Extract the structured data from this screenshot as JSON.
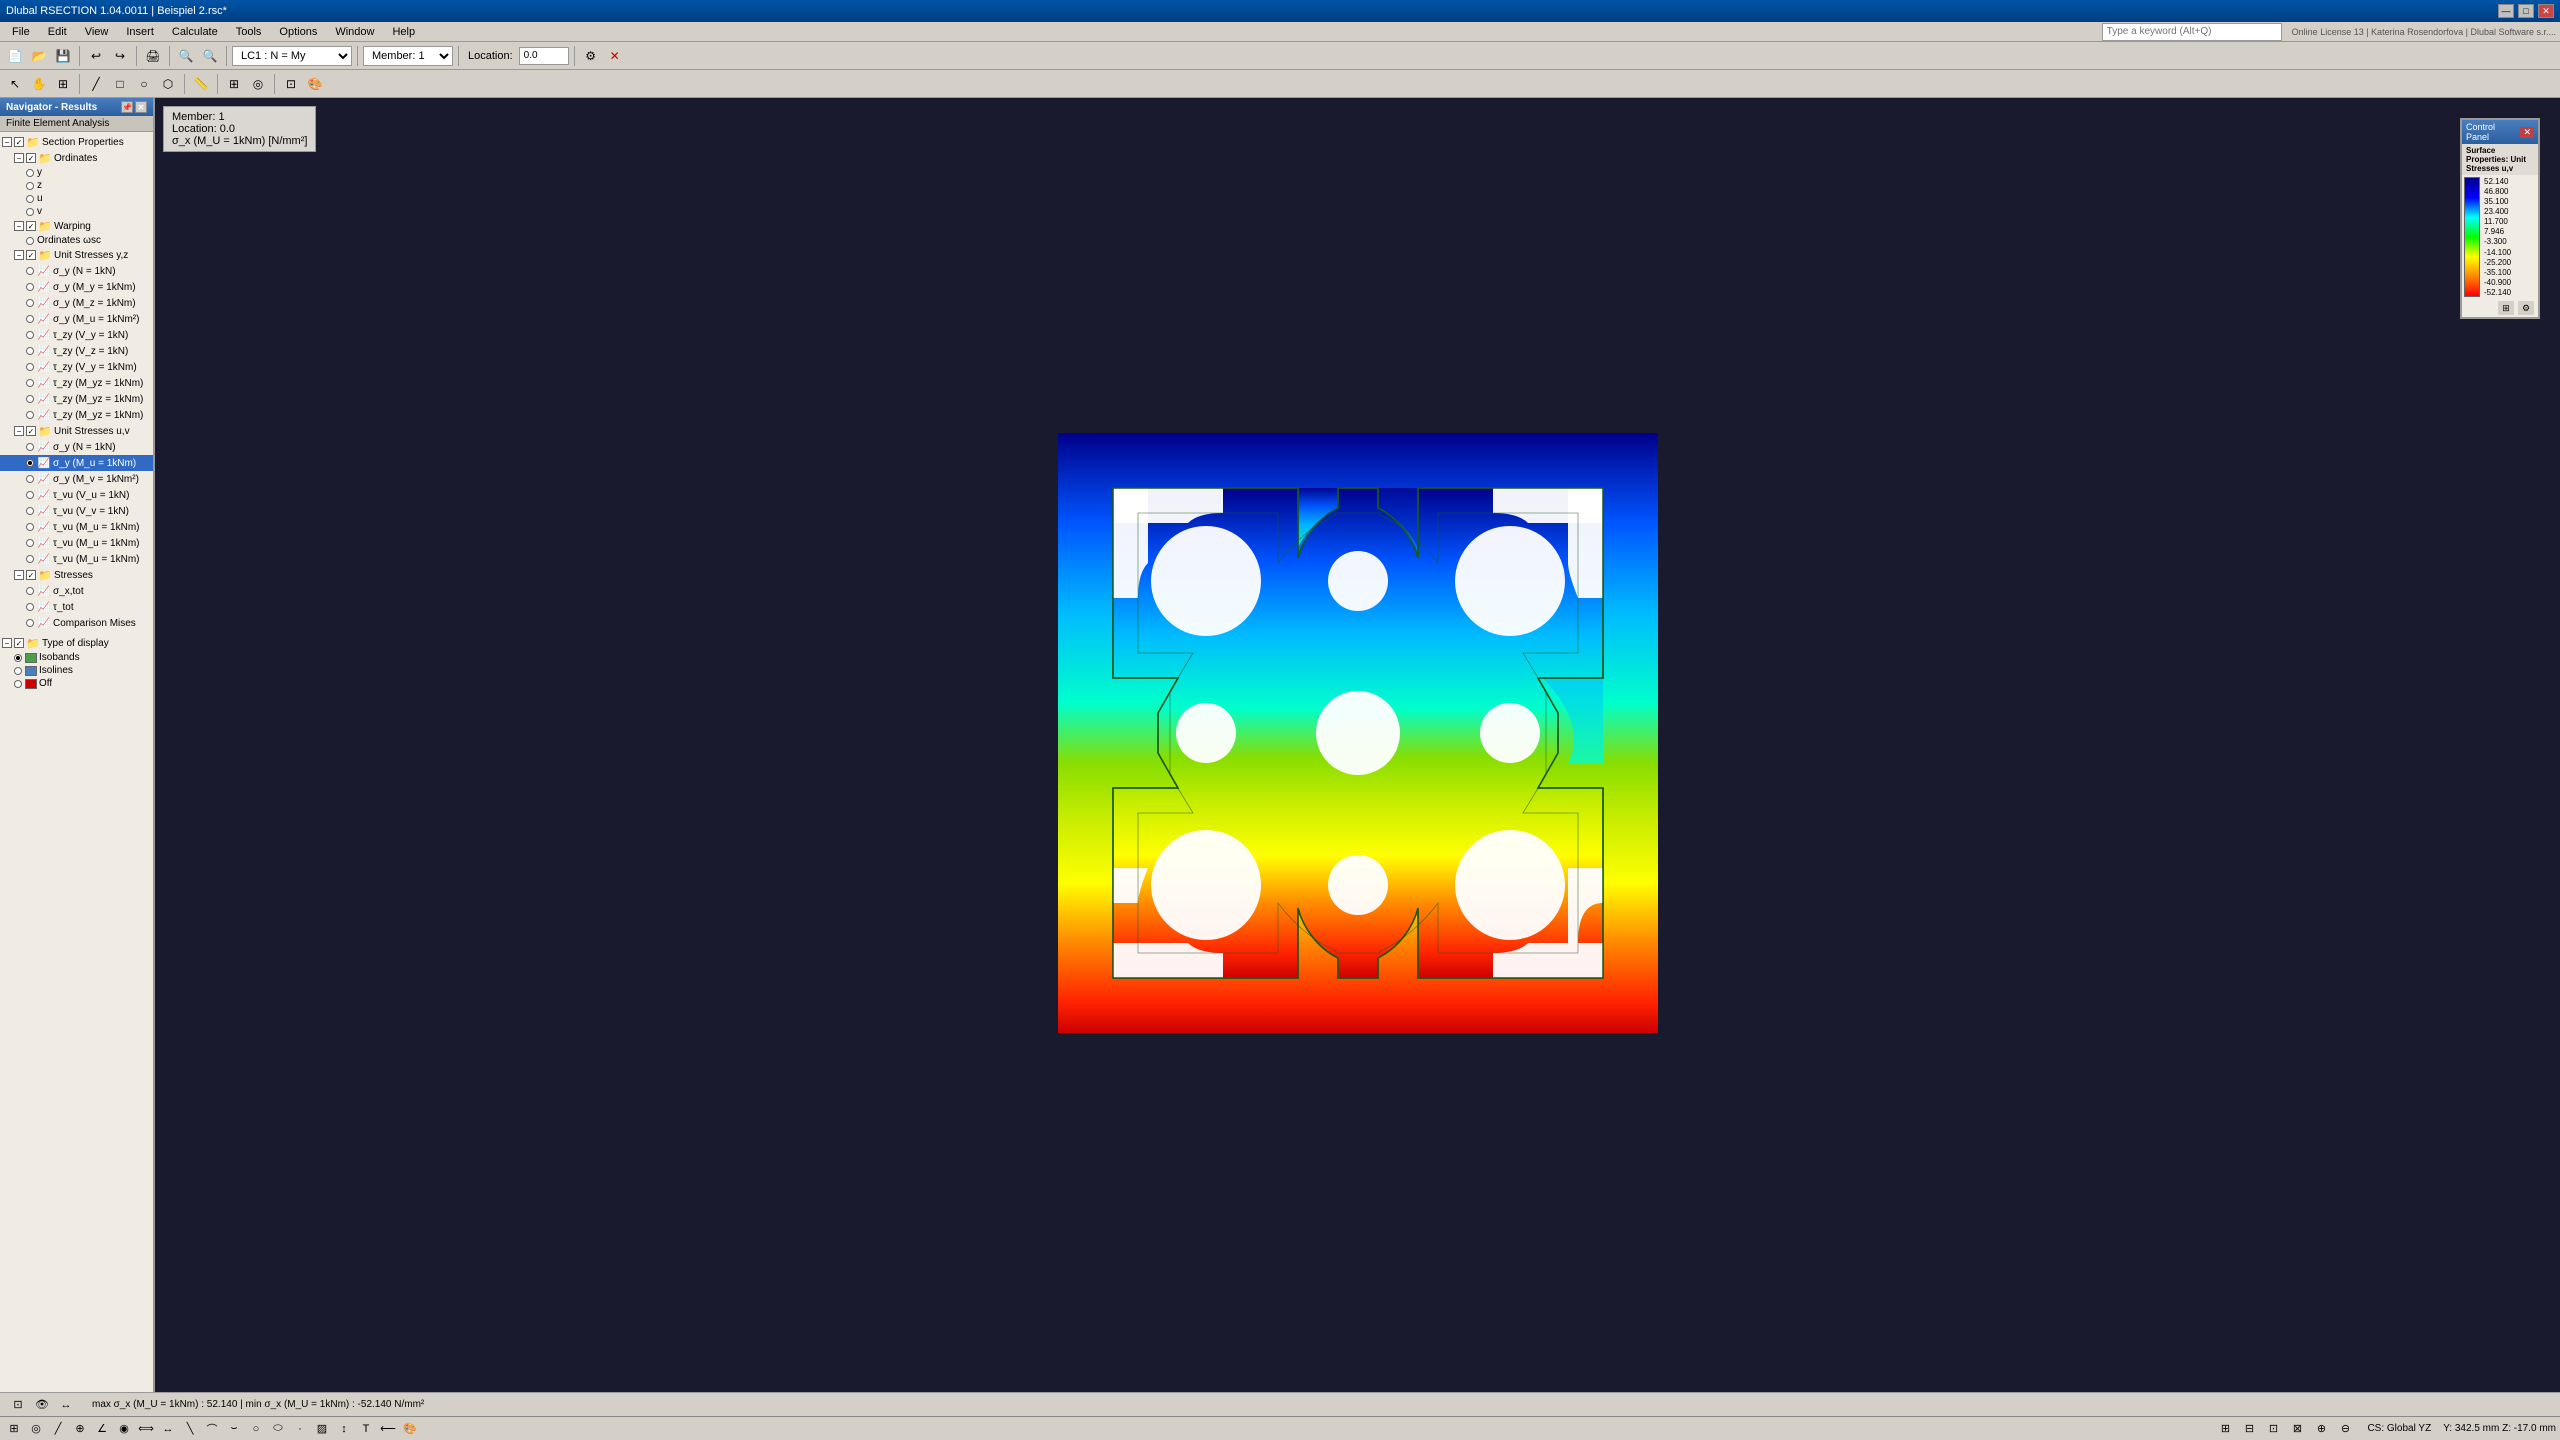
{
  "titleBar": {
    "title": "Dlubal RSECTION 1.04.0011 | Beispiel 2.rsc*",
    "buttons": [
      "—",
      "□",
      "✕"
    ]
  },
  "menuBar": {
    "items": [
      "File",
      "Edit",
      "View",
      "Insert",
      "Calculate",
      "Tools",
      "Options",
      "Window",
      "Help"
    ]
  },
  "toolbar1": {
    "lc_dropdown": "LC1 : N = My",
    "member_dropdown": "Member: 1",
    "location_label": "Location:",
    "location_value": "0.0",
    "search_placeholder": "Type a keyword (Alt+Q)",
    "license_info": "Online License 13 | Katerina Rosendorfova | Dlubal Software s.r...."
  },
  "infoPanel": {
    "line1": "Member: 1",
    "line2": "Location: 0.0",
    "line3": "σ_x (M_U = 1kNm) [N/mm²]"
  },
  "navigator": {
    "title": "Navigator - Results",
    "subTitle": "Finite Element Analysis",
    "sectionProperties": "Section Properties",
    "tree": [
      {
        "id": "section-props",
        "label": "Section Properties",
        "level": 0,
        "type": "folder",
        "expanded": true
      },
      {
        "id": "ordinates",
        "label": "Ordinates",
        "level": 1,
        "type": "folder",
        "expanded": true
      },
      {
        "id": "ord-y",
        "label": "y",
        "level": 2,
        "type": "radio"
      },
      {
        "id": "ord-z",
        "label": "z",
        "level": 2,
        "type": "radio"
      },
      {
        "id": "ord-u",
        "label": "u",
        "level": 2,
        "type": "radio"
      },
      {
        "id": "ord-v",
        "label": "v",
        "level": 2,
        "type": "radio"
      },
      {
        "id": "warping",
        "label": "Warping",
        "level": 1,
        "type": "folder",
        "expanded": true
      },
      {
        "id": "ord-wsc",
        "label": "Ordinates ωsc",
        "level": 2,
        "type": "radio"
      },
      {
        "id": "unit-stress-yz",
        "label": "Unit Stresses y,z",
        "level": 1,
        "type": "folder",
        "expanded": true
      },
      {
        "id": "sigma-n",
        "label": "σ_y (N = 1kN)",
        "level": 2,
        "type": "radio"
      },
      {
        "id": "sigma-my",
        "label": "σ_y (M_y = 1kNm)",
        "level": 2,
        "type": "radio"
      },
      {
        "id": "sigma-mz",
        "label": "σ_y (M_z = 1kNm)",
        "level": 2,
        "type": "radio"
      },
      {
        "id": "sigma-mu",
        "label": "σ_y (M_u = 1kNm²)",
        "level": 2,
        "type": "radio"
      },
      {
        "id": "tau-vy",
        "label": "τ_zy (V_y = 1kN)",
        "level": 2,
        "type": "radio"
      },
      {
        "id": "tau-vz",
        "label": "τ_zy (V_z = 1kN)",
        "level": 2,
        "type": "radio"
      },
      {
        "id": "tau-vy2",
        "label": "τ_zy (V_y = 1kNm)",
        "level": 2,
        "type": "radio"
      },
      {
        "id": "tau-myz1",
        "label": "τ_zy (M_yz = 1kNm)",
        "level": 2,
        "type": "radio"
      },
      {
        "id": "tau-myz2",
        "label": "τ_zy (M_yz = 1kNm)",
        "level": 2,
        "type": "radio"
      },
      {
        "id": "tau-myz3",
        "label": "τ_zy (M_yz = 1kNm)",
        "level": 2,
        "type": "radio"
      },
      {
        "id": "unit-stress-uv",
        "label": "Unit Stresses u,v",
        "level": 1,
        "type": "folder",
        "expanded": true
      },
      {
        "id": "sigma-n2",
        "label": "σ_y (N = 1kN)",
        "level": 2,
        "type": "radio"
      },
      {
        "id": "sigma-mu2-sel",
        "label": "σ_y (M_u = 1kNm)",
        "level": 2,
        "type": "radio",
        "selected": true
      },
      {
        "id": "sigma-mv",
        "label": "σ_y (M_v = 1kNm²)",
        "level": 2,
        "type": "radio"
      },
      {
        "id": "tau-vu1",
        "label": "τ_vu (V_u = 1kN)",
        "level": 2,
        "type": "radio"
      },
      {
        "id": "tau-vv1",
        "label": "τ_vu (V_v = 1kN)",
        "level": 2,
        "type": "radio"
      },
      {
        "id": "tau-mu1",
        "label": "τ_vu (M_u = 1kNm)",
        "level": 2,
        "type": "radio"
      },
      {
        "id": "tau-mu2",
        "label": "τ_vu (M_u = 1kNm)",
        "level": 2,
        "type": "radio"
      },
      {
        "id": "tau-mu3",
        "label": "τ_vu (M_u = 1kNm)",
        "level": 2,
        "type": "radio"
      },
      {
        "id": "stresses",
        "label": "Stresses",
        "level": 1,
        "type": "folder",
        "expanded": true
      },
      {
        "id": "sigma-x-tot",
        "label": "σ_x,tot",
        "level": 2,
        "type": "radio"
      },
      {
        "id": "tau-tot",
        "label": "τ_tot",
        "level": 2,
        "type": "radio"
      },
      {
        "id": "von-mises",
        "label": "Comparison Mises",
        "level": 2,
        "type": "radio"
      },
      {
        "id": "type-display",
        "label": "Type of display",
        "level": 0,
        "type": "folder",
        "expanded": true
      },
      {
        "id": "isobands",
        "label": "Isobands",
        "level": 1,
        "type": "radio-color",
        "color": "#4a9f4a"
      },
      {
        "id": "isolines",
        "label": "Isolines",
        "level": 1,
        "type": "radio-color",
        "color": "#4a7ebf"
      },
      {
        "id": "off",
        "label": "Off",
        "level": 1,
        "type": "radio-color-x",
        "color": "#cc0000"
      }
    ]
  },
  "legend": {
    "title": "Control Panel",
    "subtitle": "Surface Properties: Unit Stresses u,v",
    "values": [
      "52.140",
      "46.800",
      "35.100",
      "23.400",
      "11.700",
      "7.946",
      "-3.300",
      "-14.100",
      "-25.200",
      "-35.100",
      "-40.900",
      "-52.140"
    ],
    "unit": ""
  },
  "statusBar": {
    "text": "max σ_x (M_U = 1kNm) : 52.140 | min σ_x (M_U = 1kNm) : -52.140 N/mm²"
  },
  "bottomBar": {
    "right_text": "CS: Global YZ",
    "coords": "Y: 342.5 mm  Z: -17.0 mm"
  }
}
